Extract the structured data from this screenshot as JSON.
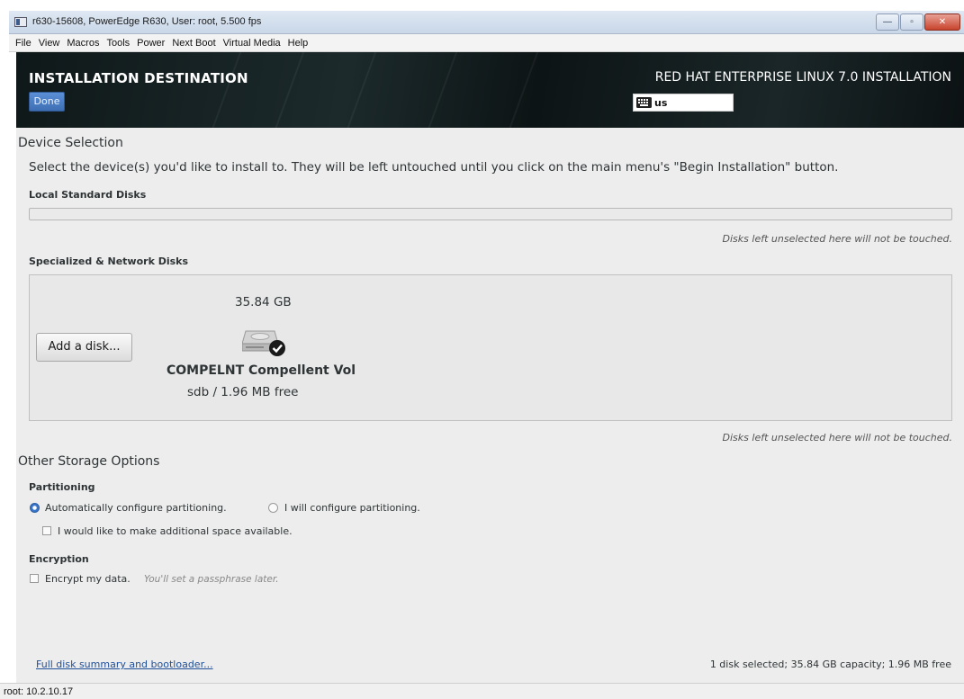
{
  "window": {
    "title": "r630-15608, PowerEdge R630, User: root, 5.500 fps",
    "controls": {
      "minimize": "—",
      "maximize": "▫",
      "close": "✕"
    },
    "menu": [
      "File",
      "View",
      "Macros",
      "Tools",
      "Power",
      "Next Boot",
      "Virtual Media",
      "Help"
    ]
  },
  "header": {
    "title": "INSTALLATION DESTINATION",
    "done_label": "Done",
    "product": "RED HAT ENTERPRISE LINUX 7.0 INSTALLATION",
    "keyboard_layout": "us"
  },
  "device_selection": {
    "title": "Device Selection",
    "description": "Select the device(s) you'd like to install to.  They will be left untouched until you click on the main menu's \"Begin Installation\" button.",
    "local_heading": "Local Standard Disks",
    "untouched_note": "Disks left unselected here will not be touched.",
    "network_heading": "Specialized & Network Disks",
    "add_disk_label": "Add a disk...",
    "disk": {
      "size": "35.84 GB",
      "name": "COMPELNT Compellent Vol",
      "device_free": "sdb   /   1.96 MB free",
      "selected": true
    },
    "untouched_note_2": "Disks left unselected here will not be touched."
  },
  "storage_options": {
    "title": "Other Storage Options",
    "partitioning_heading": "Partitioning",
    "auto_label": "Automatically configure partitioning.",
    "manual_label": "I will configure partitioning.",
    "auto_selected": true,
    "space_label": "I would like to make additional space available.",
    "encryption_heading": "Encryption",
    "encrypt_label": "Encrypt my data.",
    "encrypt_hint": "You'll set a passphrase later."
  },
  "footer": {
    "link_label": "Full disk summary and bootloader...",
    "summary": "1 disk selected; 35.84 GB capacity; 1.96 MB free"
  },
  "statusbar": {
    "text": "root: 10.2.10.17"
  },
  "colors": {
    "accent": "#3e6fb4",
    "header_bg": "#111a1b",
    "content_bg": "#ededed",
    "link": "#1f4f99"
  }
}
